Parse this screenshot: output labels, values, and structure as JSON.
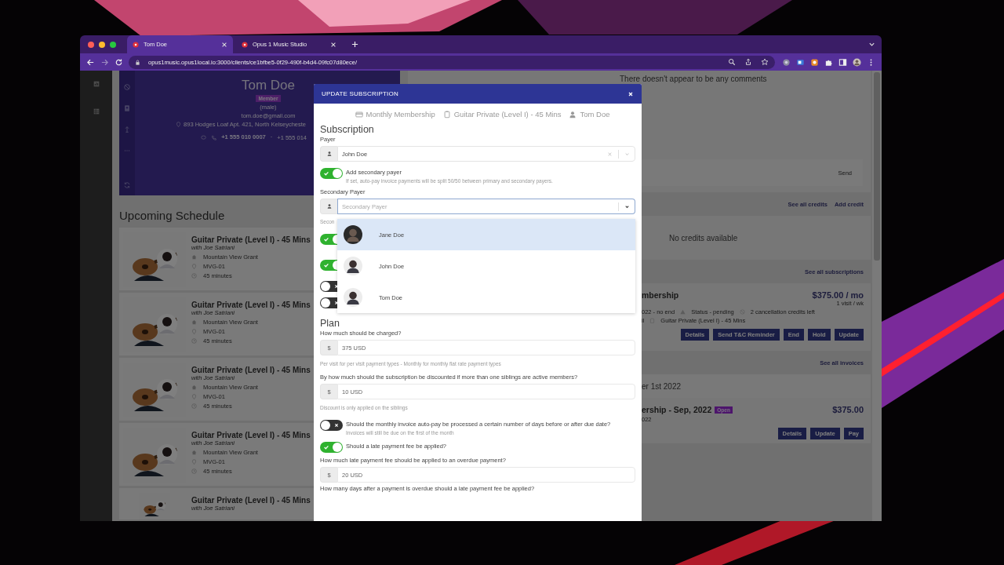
{
  "browser": {
    "tabs": [
      {
        "label": "Tom Doe",
        "selected": true
      },
      {
        "label": "Opus 1 Music Studio",
        "selected": false
      }
    ],
    "url": "opus1music.opus1local.io:3000/clients/ce1bfbe5-0f29-490f-b4d4-09fc07d80ece/"
  },
  "profile": {
    "name": "Tom Doe",
    "badge": "Member",
    "gender": "(male)",
    "email": "tom.doe@gmail.com",
    "address": "893 Hodges Loaf Apt. 421, North Kelseycheste",
    "phone": "+1 555 010 0007",
    "separator": "·",
    "phone_2": "+1 555 014"
  },
  "schedule": {
    "title": "Upcoming Schedule",
    "cards": [
      {
        "title": "Guitar Private (Level I) - 45 Mins",
        "instructor": "with Joe Satriani",
        "location": "Mountain View Grant",
        "room": "MVG-01",
        "duration": "45 minutes"
      },
      {
        "title": "Guitar Private (Level I) - 45 Mins",
        "instructor": "with Joe Satriani",
        "location": "Mountain View Grant",
        "room": "MVG-01",
        "duration": "45 minutes"
      },
      {
        "title": "Guitar Private (Level I) - 45 Mins",
        "instructor": "with Joe Satriani",
        "location": "Mountain View Grant",
        "room": "MVG-01",
        "duration": "45 minutes"
      },
      {
        "title": "Guitar Private (Level I) - 45 Mins",
        "instructor": "with Joe Satriani",
        "location": "Mountain View Grant",
        "room": "MVG-01",
        "duration": "45 minutes"
      },
      {
        "title": "Guitar Private (Level I) - 45 Mins",
        "instructor": "with Joe Satriani"
      }
    ]
  },
  "comments": {
    "empty": "There doesn't appear to be any comments",
    "send": "Send"
  },
  "credits": {
    "links": [
      "See all credits",
      "Add credit"
    ],
    "empty": "No credits available"
  },
  "subscriptions": {
    "link": "See all subscriptions",
    "name": "mbership",
    "price": "$375.00 / mo",
    "frequency": "1 visit / wk",
    "period": "022 - no end",
    "status": "Status - pending",
    "cancellations": "2 cancellation credits left",
    "owner": "il",
    "lesson": "Guitar Private (Level I) - 45 Mins",
    "buttons": [
      "Details",
      "Send T&C Reminder",
      "End",
      "Hold",
      "Update"
    ]
  },
  "invoices": {
    "link": "See all invoices",
    "month": "er 1st 2022",
    "title": "ership - Sep, 2022",
    "badge": "Open",
    "amount": "$375.00",
    "date": "022",
    "buttons": [
      "Details",
      "Update",
      "Pay"
    ]
  },
  "modal": {
    "title": "UPDATE SUBSCRIPTION",
    "meta": [
      {
        "kind": "card",
        "text": "Monthly Membership"
      },
      {
        "kind": "clipboard",
        "text": "Guitar Private (Level I) - 45 Mins"
      },
      {
        "kind": "person",
        "text": "Tom Doe"
      }
    ],
    "section": "Subscription",
    "payer_label": "Payer",
    "payer": "John Doe",
    "secondary_toggle": {
      "label": "Add secondary payer",
      "hint": "If set, auto-pay invoice payments will be split 50/50 between primary and secondary payers.",
      "on": true
    },
    "secondary_label": "Secondary Payer",
    "secondary": {
      "placeholder": "Secondary Payer",
      "expanded": true
    },
    "covered_hint": "Secon",
    "covered_toggles": [
      {
        "on": true
      },
      {
        "on": true
      },
      {
        "on": false
      },
      {
        "on": false
      }
    ],
    "options": [
      {
        "name": "Jane Doe",
        "selected": true
      },
      {
        "name": "John Doe",
        "selected": false
      },
      {
        "name": "Tom Doe",
        "selected": false
      }
    ],
    "plan": {
      "title": "Plan",
      "fields": [
        {
          "kind": "money",
          "label": "How much should be charged?",
          "currency": "$",
          "value": "375 USD",
          "hint": "Per visit for per visit payment types - Monthly for monthly flat rate payment types"
        },
        {
          "kind": "money",
          "label": "By how much should the subscription be discounted if more than one siblings are active members?",
          "currency": "$",
          "value": "10 USD",
          "hint": "Discount is only applied on the siblings"
        },
        {
          "kind": "toggle",
          "label": "Should the monthly invoice auto-pay be processed a certain number of days before or after due date?",
          "hint": "Invoices will still be due on the first of the month",
          "on": false
        },
        {
          "kind": "toggle",
          "label": "Should a late payment fee be applied?",
          "on": true
        },
        {
          "kind": "money",
          "label": "How much late payment fee should be applied to an overdue payment?",
          "currency": "$",
          "value": "20 USD"
        },
        {
          "kind": "question",
          "label": "How many days after a payment is overdue should a late payment fee be applied?"
        }
      ]
    }
  }
}
